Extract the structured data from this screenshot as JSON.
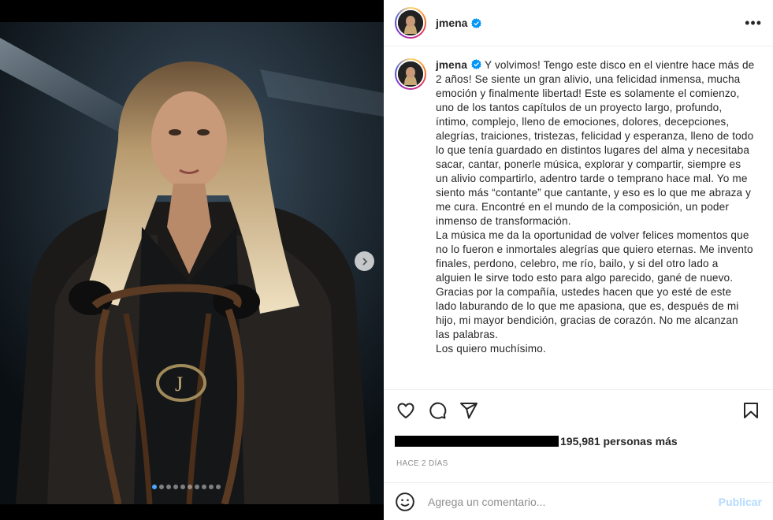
{
  "post": {
    "username": "jmena",
    "verified_icon": "verified-badge-icon",
    "more_icon": "more-options-icon"
  },
  "caption": {
    "username": "jmena",
    "paragraphs": [
      "Y volvimos! Tengo este disco en el vientre hace más de 2 años! Se siente un gran alivio, una felicidad inmensa, mucha emoción y finalmente libertad! Este es solamente el comienzo, uno de los tantos capítulos de un proyecto largo, profundo, íntimo, complejo, lleno de emociones, dolores, decepciones, alegrías, traiciones, tristezas, felicidad y esperanza, lleno de todo lo que tenía guardado en distintos lugares del alma y necesitaba sacar, cantar, ponerle música, explorar y compartir, siempre es un alivio compartirlo, adentro tarde o temprano hace mal. Yo me siento más “contante” que cantante, y eso es lo que me abraza y me cura. Encontré en el mundo de la composición, un poder inmenso de transformación.",
      "La música me da la oportunidad de volver felices momentos que no lo fueron e inmortales alegrías que quiero eternas. Me invento finales, perdono, celebro, me río, bailo, y si del otro lado a alguien le sirve todo esto para algo parecido, gané de nuevo.",
      "Gracias por la compañía, ustedes hacen que yo esté de este lado laburando de lo que me apasiona, que es, después de mi hijo, mi mayor bendición, gracias de corazón. No me alcanzan las palabras.",
      "Los quiero muchísimo."
    ]
  },
  "actions": {
    "like_icon": "heart-icon",
    "comment_icon": "comment-icon",
    "share_icon": "share-icon",
    "save_icon": "bookmark-icon"
  },
  "likes": {
    "text": "195,981 personas más"
  },
  "timestamp": "HACE 2 DÍAS",
  "comment": {
    "placeholder": "Agrega un comentario...",
    "publish_label": "Publicar"
  },
  "carousel": {
    "total": 10,
    "active": 0
  },
  "colors": {
    "accent": "#0095f6",
    "publish_disabled": "#b3dbff",
    "active_dot": "#4aa8ff"
  }
}
